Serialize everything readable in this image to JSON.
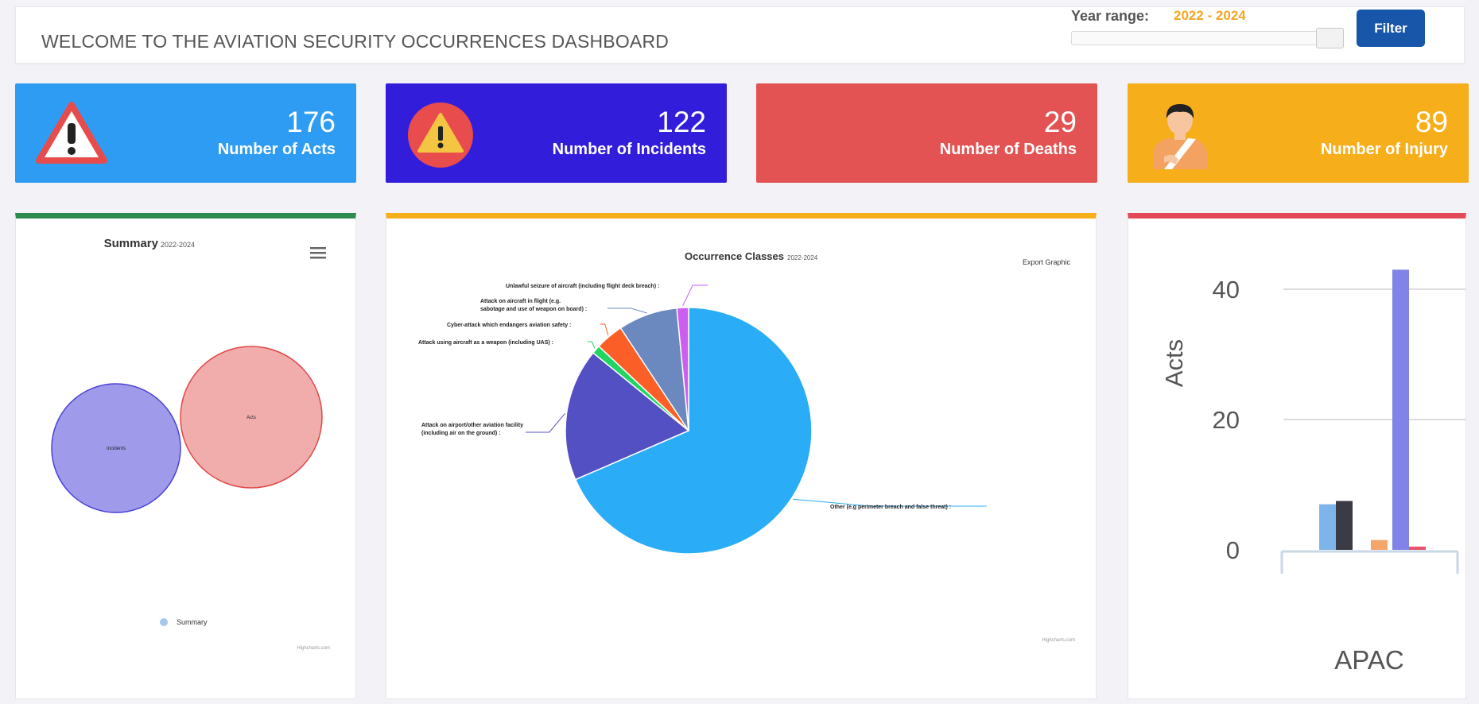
{
  "header": {
    "title": "WELCOME TO THE AVIATION SECURITY OCCURRENCES DASHBOARD",
    "year_range_label": "Year range:",
    "year_range_value": "2022 - 2024",
    "filter_label": "Filter"
  },
  "cards": [
    {
      "value": "176",
      "label": "Number of Acts",
      "icon": "warning-triangle-icon",
      "color": "#2e9cf3"
    },
    {
      "value": "122",
      "label": "Number of Incidents",
      "icon": "warning-circle-icon",
      "color": "#321ddb"
    },
    {
      "value": "29",
      "label": "Number of Deaths",
      "icon": "",
      "color": "#e45353"
    },
    {
      "value": "89",
      "label": "Number of Injury",
      "icon": "injured-person-icon",
      "color": "#f6ae1b"
    }
  ],
  "summary": {
    "title": "Summary",
    "subtitle": "2022-2024",
    "menu_icon": "hamburger-menu-icon",
    "set_incidents": "Incidents",
    "set_acts": "Acts",
    "legend": "Summary",
    "credits": "Highcharts.com",
    "colors": {
      "incidents": "#8f88e8",
      "acts": "#f0a3a3"
    }
  },
  "occurrence": {
    "title": "Occurrence Classes",
    "subtitle": "2022-2024",
    "export_label": "Export Graphic",
    "credits": "Highcharts.com"
  },
  "acts_chart": {
    "ylabel": "Acts",
    "yticks": [
      "40",
      "20",
      "0"
    ],
    "category": "APAC"
  },
  "chart_data": [
    {
      "type": "pie",
      "title": "Occurrence Classes",
      "subtitle": "2022-2024",
      "slices": [
        {
          "label": "Other (e.g perimeter breach and false threat) :",
          "value": 67.0,
          "color": "#2aacf7"
        },
        {
          "label": "Attack on airport/other aviation facility (including air on the ground) :",
          "value": 17.0,
          "color": "#5350c4"
        },
        {
          "label": "Attack using aircraft as a weapon (including UAS) :",
          "value": 1.1,
          "color": "#22d563"
        },
        {
          "label": "Cyber-attack which endangers aviation safety :",
          "value": 3.6,
          "color": "#fb5f27"
        },
        {
          "label": "Attack on aircraft in flight (e.g. sabotage and use of weapon on board) :",
          "value": 7.6,
          "color": "#6b88bf"
        },
        {
          "label": "Unlawful seizure of aircraft (including flight deck breach) :",
          "value": 1.5,
          "color": "#cc5ef0"
        }
      ]
    },
    {
      "type": "bar",
      "categories": [
        "APAC"
      ],
      "ylabel": "Acts",
      "ylim": [
        0,
        42
      ],
      "series": [
        {
          "values": [
            7
          ],
          "color": "#7db5ea"
        },
        {
          "values": [
            7.5
          ],
          "color": "#3a3b45"
        },
        {
          "values": [
            1.5
          ],
          "color": "#f5a46a"
        },
        {
          "values": [
            43
          ],
          "color": "#8184e6"
        },
        {
          "values": [
            0.5
          ],
          "color": "#e8546e"
        }
      ]
    }
  ]
}
